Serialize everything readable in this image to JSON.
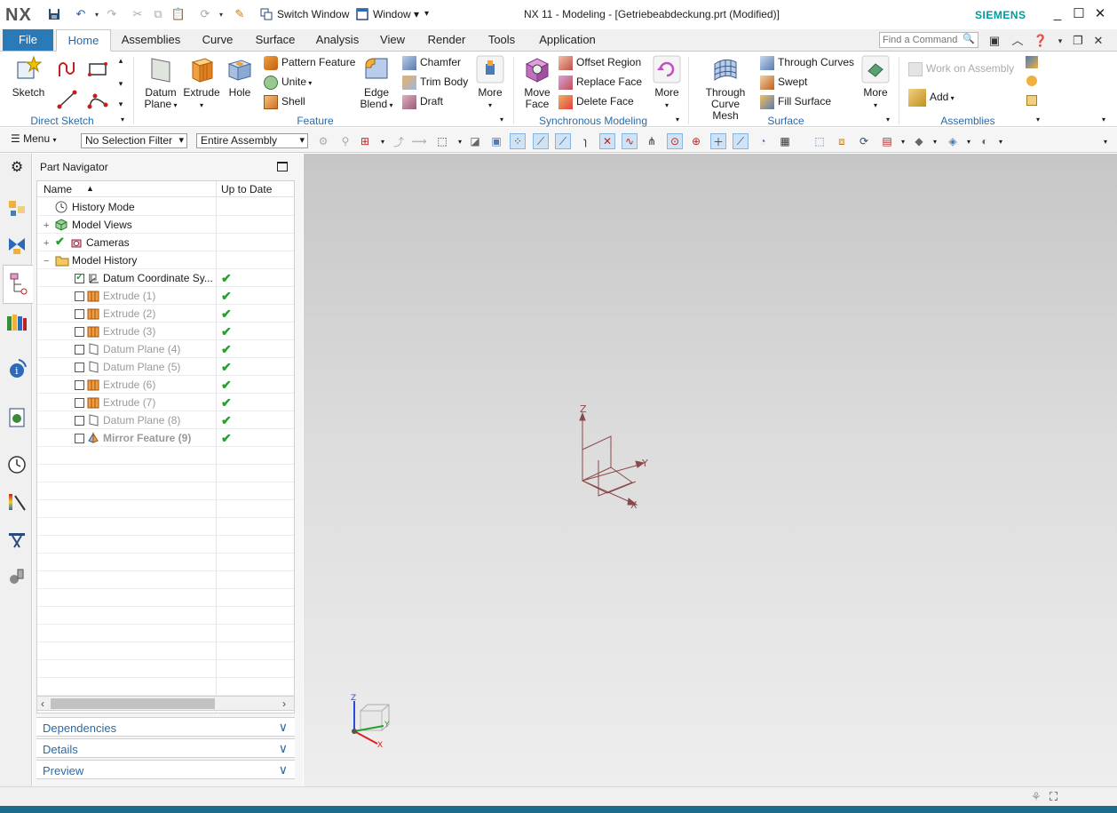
{
  "app": {
    "logo": "NX",
    "window_title": "NX 11 - Modeling - [Getriebeabdeckung.prt (Modified)]",
    "vendor": "SIEMENS"
  },
  "quick_access": {
    "switch_window": "Switch Window",
    "window": "Window"
  },
  "tabs": {
    "file": "File",
    "items": [
      "Home",
      "Assemblies",
      "Curve",
      "Surface",
      "Analysis",
      "View",
      "Render",
      "Tools",
      "Application"
    ],
    "active": "Home",
    "find_placeholder": "Find a Command"
  },
  "ribbon": {
    "direct_sketch": {
      "label": "Direct Sketch",
      "sketch": "Sketch"
    },
    "feature": {
      "label": "Feature",
      "datum_plane": "Datum\nPlane",
      "datum_plane_1": "Datum",
      "datum_plane_2": "Plane",
      "extrude": "Extrude",
      "hole": "Hole",
      "pattern_feature": "Pattern Feature",
      "unite": "Unite",
      "shell": "Shell",
      "edge_blend_1": "Edge",
      "edge_blend_2": "Blend",
      "chamfer": "Chamfer",
      "trim_body": "Trim Body",
      "draft": "Draft",
      "more": "More"
    },
    "synchronous": {
      "label": "Synchronous Modeling",
      "move_face_1": "Move",
      "move_face_2": "Face",
      "offset_region": "Offset Region",
      "replace_face": "Replace Face",
      "delete_face": "Delete Face",
      "more": "More"
    },
    "surface": {
      "label": "Surface",
      "through_mesh_1": "Through",
      "through_mesh_2": "Curve Mesh",
      "through_curves": "Through Curves",
      "swept": "Swept",
      "fill_surface": "Fill Surface",
      "more": "More"
    },
    "assemblies": {
      "label": "Assemblies",
      "work_on_assembly": "Work on Assembly",
      "add": "Add"
    }
  },
  "selection_bar": {
    "menu": "Menu",
    "filter": "No Selection Filter",
    "scope": "Entire Assembly"
  },
  "navigator": {
    "title": "Part Navigator",
    "col_name": "Name",
    "col_uptodate": "Up to Date",
    "rows": [
      {
        "label": "History Mode",
        "indent": 0
      },
      {
        "label": "Model Views",
        "indent": 0
      },
      {
        "label": "Cameras",
        "indent": 0
      },
      {
        "label": "Model History",
        "indent": 0
      },
      {
        "label": "Datum Coordinate Sy...",
        "indent": 1
      },
      {
        "label": "Extrude (1)",
        "indent": 1
      },
      {
        "label": "Extrude (2)",
        "indent": 1
      },
      {
        "label": "Extrude (3)",
        "indent": 1
      },
      {
        "label": "Datum Plane (4)",
        "indent": 1
      },
      {
        "label": "Datum Plane (5)",
        "indent": 1
      },
      {
        "label": "Extrude (6)",
        "indent": 1
      },
      {
        "label": "Extrude (7)",
        "indent": 1
      },
      {
        "label": "Datum Plane (8)",
        "indent": 1
      },
      {
        "label": "Mirror Feature (9)",
        "indent": 1
      }
    ],
    "panels": [
      "Dependencies",
      "Details",
      "Preview"
    ]
  },
  "csys": {
    "x": "X",
    "y": "Y",
    "z": "Z"
  },
  "colors": {
    "accent": "#2b7ab8",
    "check": "#27a02b",
    "csys": "#8a4a4a"
  }
}
